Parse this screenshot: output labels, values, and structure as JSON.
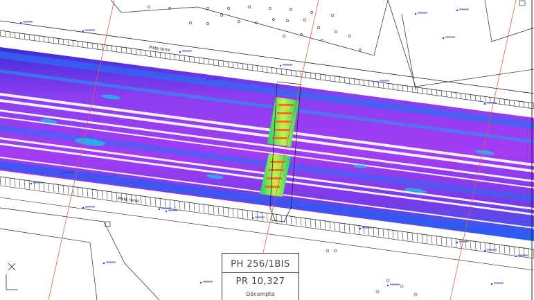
{
  "map": {
    "colors": {
      "background": "#ffffff",
      "linework": "#222222",
      "gridline_red": "#e05a4a",
      "label_blue": "#1a3cc8",
      "scan_low": "#9a3cf0",
      "scan_mid": "#1e8cff",
      "scan_high": "#19d36b",
      "scan_peak": "#ffd21a"
    },
    "track_labels": {
      "top": "Piste terre",
      "bottom": "Piste terre"
    },
    "title_block": {
      "ph": "PH 256/1BIS",
      "pr": "PR 10,327",
      "direction": "Décompte"
    },
    "icons": [
      "north-axis-icon"
    ]
  }
}
